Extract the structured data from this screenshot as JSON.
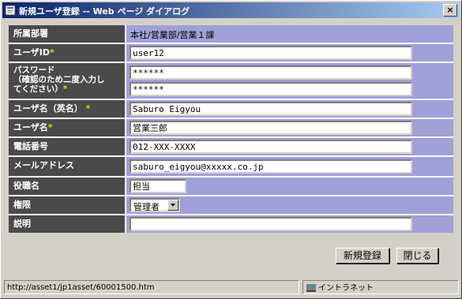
{
  "window": {
    "title": "新規ユーザ登録 -- Web ページ ダイアログ",
    "close_label": "×"
  },
  "form": {
    "department": {
      "label": "所属部署",
      "value": "本社/営業部/営業１課"
    },
    "user_id": {
      "label": "ユーザID",
      "value": "user12"
    },
    "password": {
      "label_line1": "パスワード",
      "label_line2": "（確認のため二度入力し",
      "label_line3": "てください）",
      "value1": "******",
      "value2": "******"
    },
    "user_name_en": {
      "label": "ユーザ名（英名）",
      "value": "Saburo Eigyou"
    },
    "user_name": {
      "label": "ユーザ名",
      "value": "営業三郎"
    },
    "phone": {
      "label": "電話番号",
      "value": "012-XXX-XXXX"
    },
    "email": {
      "label": "メールアドレス",
      "value": "saburo_eigyou@xxxxx.co.jp"
    },
    "title": {
      "label": "役職名",
      "value": "担当"
    },
    "role": {
      "label": "権限",
      "value": "管理者"
    },
    "description": {
      "label": "説明",
      "value": ""
    },
    "required_mark": "*"
  },
  "buttons": {
    "register": "新規登録",
    "close": "閉じる"
  },
  "statusbar": {
    "url": "http://asset1/jp1asset/60001500.htm",
    "zone": "イントラネット"
  }
}
